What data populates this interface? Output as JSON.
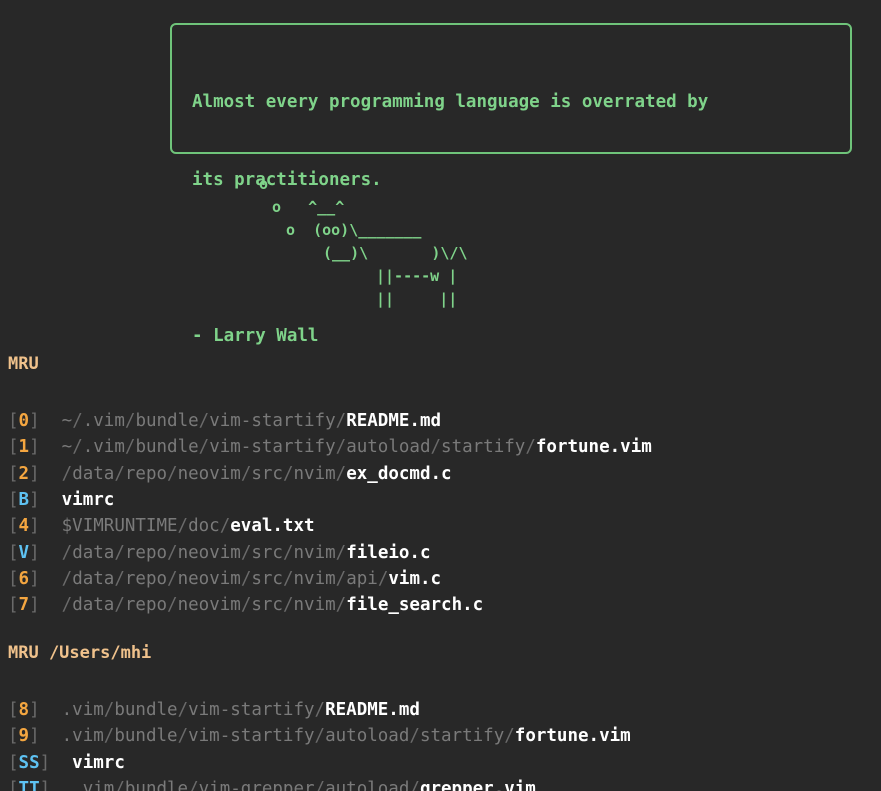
{
  "quote": {
    "lines": [
      "Almost every programming language is overrated by",
      "its practitioners.",
      "",
      "- Larry Wall"
    ]
  },
  "cow": {
    "lines": [
      "o",
      "o   ^__^",
      "o  (oo)\\_______",
      "(__)\\       )\\/\\",
      "||----w |",
      "||     ||"
    ]
  },
  "sections": [
    {
      "header": "MRU",
      "entries": [
        {
          "index": "0",
          "index_type": "number",
          "dir": "~/.vim/bundle/vim-startify/",
          "file": "README.md"
        },
        {
          "index": "1",
          "index_type": "number",
          "dir": "~/.vim/bundle/vim-startify/autoload/startify/",
          "file": "fortune.vim"
        },
        {
          "index": "2",
          "index_type": "number",
          "dir": "/data/repo/neovim/src/nvim/",
          "file": "ex_docmd.c"
        },
        {
          "index": "B",
          "index_type": "key",
          "dir": "",
          "file": "vimrc"
        },
        {
          "index": "4",
          "index_type": "number",
          "dir": "$VIMRUNTIME/doc/",
          "file": "eval.txt"
        },
        {
          "index": "V",
          "index_type": "key",
          "dir": "/data/repo/neovim/src/nvim/",
          "file": "fileio.c"
        },
        {
          "index": "6",
          "index_type": "number",
          "dir": "/data/repo/neovim/src/nvim/api/",
          "file": "vim.c"
        },
        {
          "index": "7",
          "index_type": "number",
          "dir": "/data/repo/neovim/src/nvim/",
          "file": "file_search.c"
        }
      ]
    },
    {
      "header": "MRU /Users/mhi",
      "entries": [
        {
          "index": "8",
          "index_type": "number",
          "dir": ".vim/bundle/vim-startify/",
          "file": "README.md"
        },
        {
          "index": "9",
          "index_type": "number",
          "dir": ".vim/bundle/vim-startify/autoload/startify/",
          "file": "fortune.vim"
        },
        {
          "index": "SS",
          "index_type": "key",
          "dir": "",
          "file": "vimrc"
        },
        {
          "index": "TT",
          "index_type": "key",
          "dir": ".vim/bundle/vim-grepper/autoload/",
          "file": "grepper.vim"
        }
      ]
    }
  ],
  "colors": {
    "background": "#282828",
    "quote_green": "#7fd38a",
    "header_orange": "#f0c28c",
    "index_number": "#f4a640",
    "index_key": "#5ec2f2",
    "path_gray": "#7a7a7a",
    "filename_white": "#ffffff"
  }
}
